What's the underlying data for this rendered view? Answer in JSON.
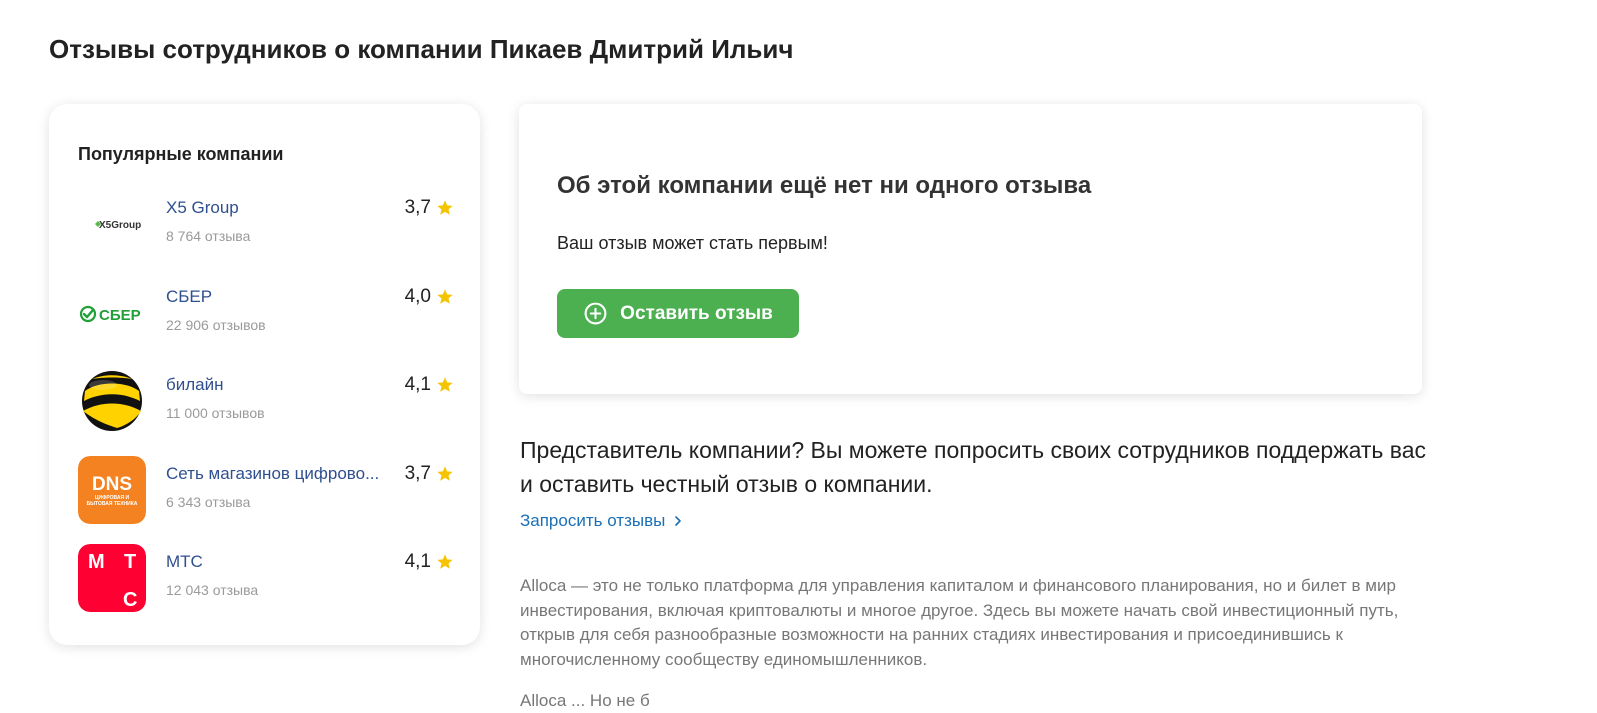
{
  "page": {
    "title": "Отзывы сотрудников о компании Пикаев Дмитрий Ильич"
  },
  "popular": {
    "title": "Популярные компании",
    "companies": [
      {
        "name": "X5 Group",
        "reviews": "8 764 отзыва",
        "rating": "3,7",
        "logo_text": "X5Group",
        "logo_icon": "x5-group-logo"
      },
      {
        "name": "СБЕР",
        "reviews": "22 906 отзывов",
        "rating": "4,0",
        "logo_text": "СБЕР",
        "logo_icon": "sber-logo"
      },
      {
        "name": "билайн",
        "reviews": "11 000 отзывов",
        "rating": "4,1",
        "logo_text": "",
        "logo_icon": "beeline-logo"
      },
      {
        "name": "Сеть магазинов цифрово...",
        "reviews": "6 343 отзыва",
        "rating": "3,7",
        "logo_text": "DNS",
        "logo_subtext": "ЦИФРОВАЯ И БЫТОВАЯ ТЕХНИКА",
        "logo_icon": "dns-logo"
      },
      {
        "name": "МТС",
        "reviews": "12 043 отзыва",
        "rating": "4,1",
        "logo_text": "МТС",
        "logo_icon": "mts-logo"
      }
    ]
  },
  "empty_review": {
    "title": "Об этой компании ещё нет ни одного отзыва",
    "subtitle": "Ваш отзыв может стать первым!",
    "button_label": "Оставить отзыв"
  },
  "representative": {
    "text": "Представитель компании? Вы можете попросить своих сотрудников поддержать вас и оставить честный отзыв о компании.",
    "link_label": "Запросить отзывы"
  },
  "description": {
    "text": "Alloca — это не только платформа для управления капиталом и финансового планирования, но и билет в мир инвестирования, включая криптовалюты и многое другое. Здесь вы можете начать свой инвестиционный путь, открыв для себя разнообразные возможности на ранних стадиях инвестирования и присоединившись к многочисленному сообществу единомышленников.",
    "next_line_fragment": "Alloca ... Но не б"
  },
  "colors": {
    "accent_green": "#4caf50",
    "link_blue": "#1a6fb6",
    "company_link": "#2f4f8f",
    "star_yellow": "#f5c400"
  }
}
